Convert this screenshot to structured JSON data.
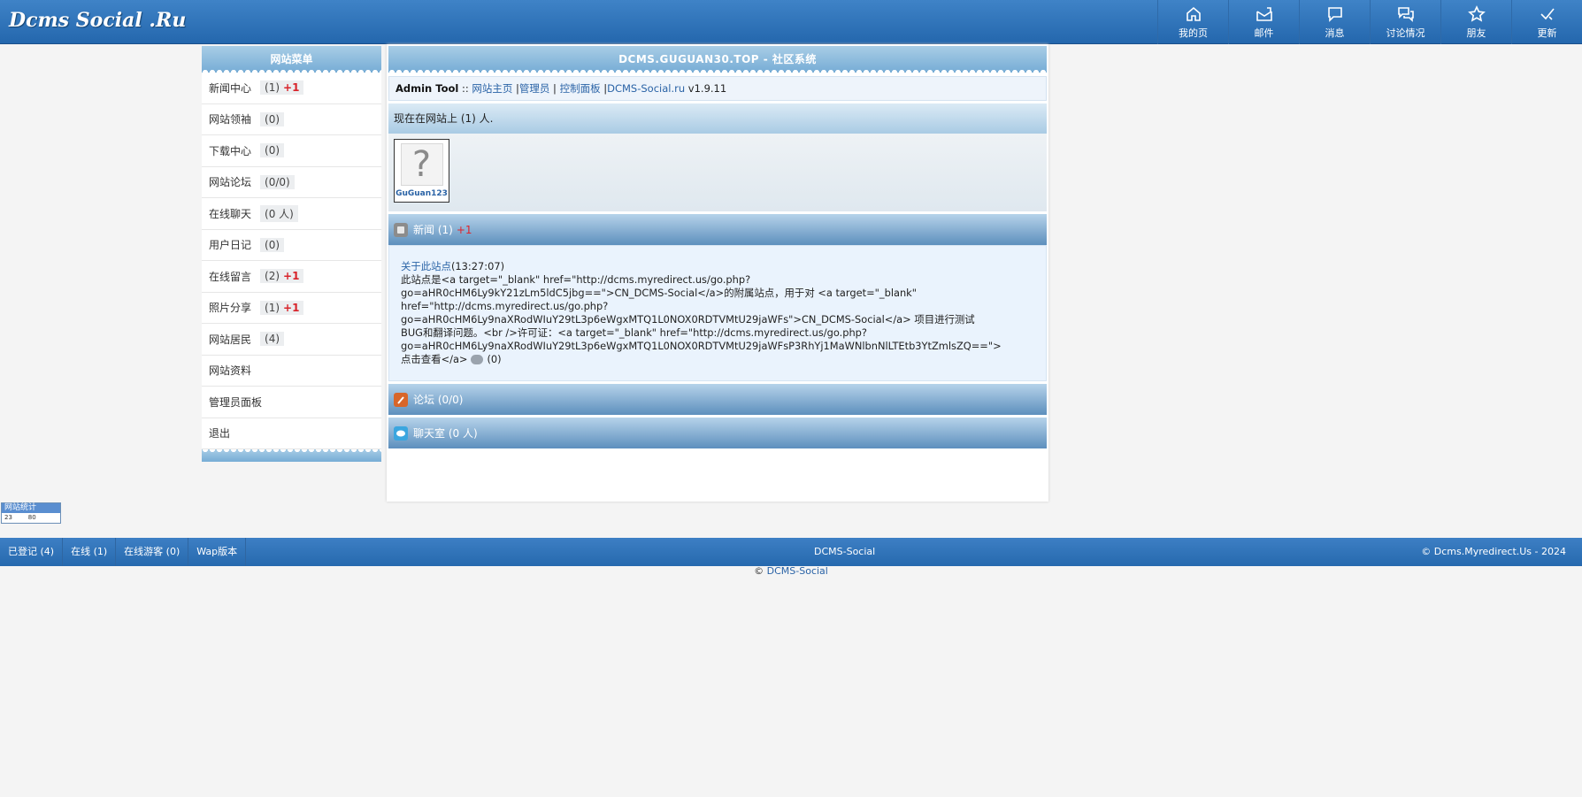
{
  "site": {
    "logo": "Dcms Social .Ru"
  },
  "topnav": [
    {
      "label": "我的页",
      "icon": "home-icon"
    },
    {
      "label": "邮件",
      "icon": "mail-icon"
    },
    {
      "label": "消息",
      "icon": "message-icon"
    },
    {
      "label": "讨论情况",
      "icon": "discussion-icon"
    },
    {
      "label": "朋友",
      "icon": "star-icon"
    },
    {
      "label": "更新",
      "icon": "check-icon"
    }
  ],
  "sidebar": {
    "title": "网站菜单",
    "items": [
      {
        "label": "新闻中心",
        "count": "(1)",
        "plus": "+1"
      },
      {
        "label": "网站领袖",
        "count": "(0)",
        "plus": ""
      },
      {
        "label": "下载中心",
        "count": "(0)",
        "plus": ""
      },
      {
        "label": "网站论坛",
        "count": "(0/0)",
        "plus": ""
      },
      {
        "label": "在线聊天",
        "count": "(0 人)",
        "plus": ""
      },
      {
        "label": "用户日记",
        "count": "(0)",
        "plus": ""
      },
      {
        "label": "在线留言",
        "count": "(2)",
        "plus": "+1"
      },
      {
        "label": "照片分享",
        "count": "(1)",
        "plus": "+1"
      },
      {
        "label": "网站居民",
        "count": "(4)",
        "plus": ""
      },
      {
        "label": "网站资料",
        "count": "",
        "plus": ""
      },
      {
        "label": "管理员面板",
        "count": "",
        "plus": ""
      },
      {
        "label": "退出",
        "count": "",
        "plus": ""
      }
    ]
  },
  "main": {
    "title": "DCMS.GUGUAN30.TOP - 社区系统",
    "toolbar": {
      "prefix": "Admin Tool",
      "sep": " :: ",
      "link1": "网站主页",
      "link2": "管理员",
      "link3": "控制面板",
      "link4": "DCMS-Social.ru",
      "version": " v1.9.11"
    },
    "online": "现在在网站上 (1) 人.",
    "user": {
      "name": "GuGuan123",
      "avatar_glyph": "?"
    },
    "news": {
      "header": "新闻 (1)",
      "plus": "+1",
      "title": "关于此站点",
      "time": "(13:27:07)",
      "lines": [
        "此站点是<a target=\"_blank\" href=\"http://dcms.myredirect.us/go.php?",
        "go=aHR0cHM6Ly9kY21zLm5ldC5jbg==\">CN_DCMS-Social</a>的附属站点，用于对 <a target=\"_blank\"",
        "href=\"http://dcms.myredirect.us/go.php?",
        "go=aHR0cHM6Ly9naXRodWIuY29tL3p6eWgxMTQ1L0NOX0RDTVMtU29jaWFs\">CN_DCMS-Social</a> 项目进行测试",
        "BUG和翻译问题。<br />许可证：<a target=\"_blank\" href=\"http://dcms.myredirect.us/go.php?",
        "go=aHR0cHM6Ly9naXRodWIuY29tL3p6eWgxMTQ1L0NOX0RDTVMtU29jaWFsP3RhYj1MaWNlbnNlLTEtb3YtZmlsZQ==\">"
      ],
      "last_line": "点击查看</a>",
      "comments": "(0)"
    },
    "forum": {
      "header": "论坛 (0/0)"
    },
    "chat": {
      "header": "聊天室 (0 人)"
    }
  },
  "counter": {
    "label": "网站统计",
    "n1": "23",
    "n2": "80"
  },
  "footer": {
    "links": [
      "已登记 (4)",
      "在线 (1)",
      "在线游客 (0)",
      "Wap版本"
    ],
    "center": "DCMS-Social",
    "right": "© Dcms.Myredirect.Us - 2024",
    "copy_prefix": "© ",
    "copy_link": "DCMS-Social"
  },
  "colors": {
    "accent": "#2a63a6",
    "header": "#2f72b8",
    "plus": "#d8232a"
  }
}
